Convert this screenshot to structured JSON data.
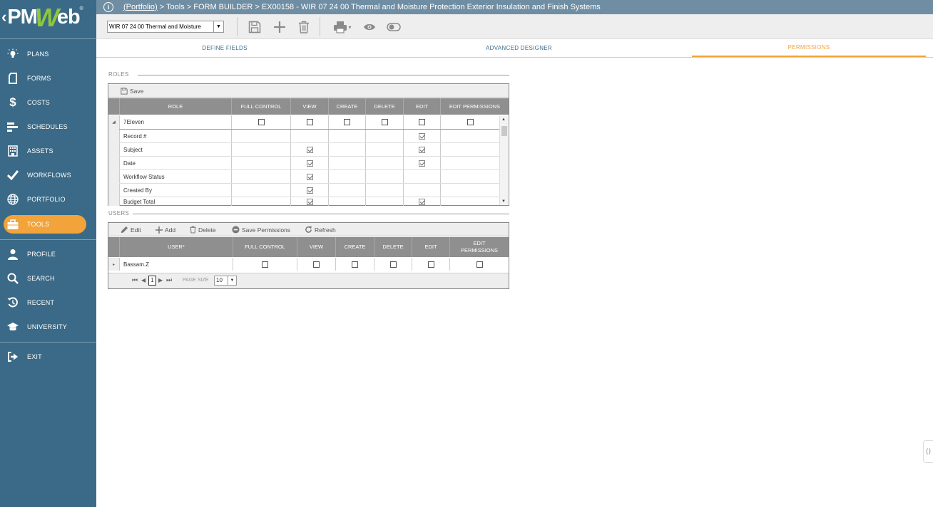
{
  "logo": {
    "chevron": "‹",
    "pm": "PM",
    "w": "W",
    "eb": "eb",
    "reg": "®"
  },
  "sidebar": {
    "items": [
      {
        "label": "PLANS",
        "icon": "lightbulb-icon"
      },
      {
        "label": "FORMS",
        "icon": "document-icon"
      },
      {
        "label": "COSTS",
        "icon": "dollar-icon"
      },
      {
        "label": "SCHEDULES",
        "icon": "schedule-bars-icon"
      },
      {
        "label": "ASSETS",
        "icon": "building-icon"
      },
      {
        "label": "WORKFLOWS",
        "icon": "checkmark-icon"
      },
      {
        "label": "PORTFOLIO",
        "icon": "globe-icon"
      },
      {
        "label": "TOOLS",
        "icon": "briefcase-icon"
      },
      {
        "label": "PROFILE",
        "icon": "user-icon"
      },
      {
        "label": "SEARCH",
        "icon": "search-icon"
      },
      {
        "label": "RECENT",
        "icon": "history-icon"
      },
      {
        "label": "UNIVERSITY",
        "icon": "graduation-cap-icon"
      },
      {
        "label": "EXIT",
        "icon": "exit-icon"
      }
    ],
    "active": "TOOLS"
  },
  "header": {
    "info_icon": "i",
    "portfolio_link": "(Portfolio)",
    "breadcrumb_rest": " > Tools > FORM BUILDER > EX00158 - WIR 07 24 00 Thermal and Moisture Protection Exterior Insulation and Finish Systems"
  },
  "toolbar": {
    "form_select_value": "WIR 07 24 00 Thermal and Moisture",
    "form_select_arrow": "▼",
    "print_arrow": "▾"
  },
  "tabs": [
    {
      "label": "DEFINE FIELDS"
    },
    {
      "label": "ADVANCED DESIGNER"
    },
    {
      "label": "PERMISSIONS"
    }
  ],
  "roles": {
    "section_title": "ROLES",
    "save_label": "Save",
    "columns": [
      "ROLE",
      "FULL CONTROL",
      "VIEW",
      "CREATE",
      "DELETE",
      "EDIT",
      "EDIT PERMISSIONS"
    ],
    "group": {
      "name": "7Eleven",
      "expander": "◢",
      "full_control": false,
      "view": false,
      "create": false,
      "delete": false,
      "edit": false,
      "edit_permissions": false
    },
    "fields": [
      {
        "name": "Record #",
        "view": null,
        "edit": true
      },
      {
        "name": "Subject",
        "view": true,
        "edit": true
      },
      {
        "name": "Date",
        "view": true,
        "edit": true
      },
      {
        "name": "Workflow Status",
        "view": true,
        "edit": null
      },
      {
        "name": "Created By",
        "view": true,
        "edit": null
      },
      {
        "name": "Budget Total",
        "view": true,
        "edit": true
      }
    ],
    "scroll_up": "▲",
    "scroll_down": "▼"
  },
  "users": {
    "section_title": "USERS",
    "toolbar": {
      "edit": "Edit",
      "add": "Add",
      "delete": "Delete",
      "save_permissions": "Save Permissions",
      "refresh": "Refresh"
    },
    "columns": [
      "USER*",
      "FULL CONTROL",
      "VIEW",
      "CREATE",
      "DELETE",
      "EDIT",
      "EDIT PERMISSIONS"
    ],
    "rows": [
      {
        "name": "Bassam.Z",
        "expander": "▸",
        "full_control": false,
        "view": false,
        "create": false,
        "delete": false,
        "edit": false,
        "edit_permissions": false
      }
    ],
    "pager": {
      "first": "⏮",
      "prev": "◀",
      "page": "1",
      "next": "▶",
      "last": "⏭",
      "page_size_label": "PAGE SIZE",
      "page_size": "10",
      "page_size_arrow": "▼"
    }
  },
  "side_handle": "⟨⟩"
}
